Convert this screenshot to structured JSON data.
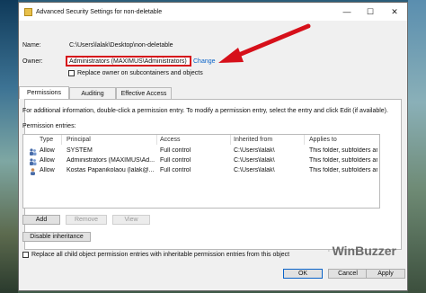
{
  "window": {
    "title": "Advanced Security Settings for non-deletable",
    "minimize": "—",
    "maximize": "☐",
    "close": "✕"
  },
  "info": {
    "name_label": "Name:",
    "name_value": "C:\\Users\\lalak\\Desktop\\non-deletable",
    "owner_label": "Owner:",
    "owner_value": "Administrators (MAXIMUS\\Administrators)",
    "change_link": "Change",
    "replace_owner_label": "Replace owner on subcontainers and objects"
  },
  "tabs": [
    {
      "label": "Permissions"
    },
    {
      "label": "Auditing"
    },
    {
      "label": "Effective Access"
    }
  ],
  "permissions": {
    "info_text": "For additional information, double-click a permission entry. To modify a permission entry, select the entry and click Edit (if available).",
    "entries_label": "Permission entries:",
    "columns": [
      "Type",
      "Principal",
      "Access",
      "Inherited from",
      "Applies to"
    ],
    "rows": [
      {
        "type": "Allow",
        "principal": "SYSTEM",
        "access": "Full control",
        "inherited": "C:\\Users\\lalak\\",
        "applies": "This folder, subfolders and files"
      },
      {
        "type": "Allow",
        "principal": "Administrators (MAXIMUS\\Ad...",
        "access": "Full control",
        "inherited": "C:\\Users\\lalak\\",
        "applies": "This folder, subfolders and files"
      },
      {
        "type": "Allow",
        "principal": "Kostas Papanikolaou (lalak@...",
        "access": "Full control",
        "inherited": "C:\\Users\\lalak\\",
        "applies": "This folder, subfolders and files"
      }
    ]
  },
  "buttons": {
    "add": "Add",
    "remove": "Remove",
    "view": "View",
    "disable_inheritance": "Disable inheritance",
    "replace_all_label": "Replace all child object permission entries with inheritable permission entries from this object",
    "ok": "OK",
    "cancel": "Cancel",
    "apply": "Apply"
  },
  "watermark": {
    "text": "WinBuzzer"
  },
  "colors": {
    "accent_red": "#d6101a",
    "link_blue": "#0a63c8"
  }
}
